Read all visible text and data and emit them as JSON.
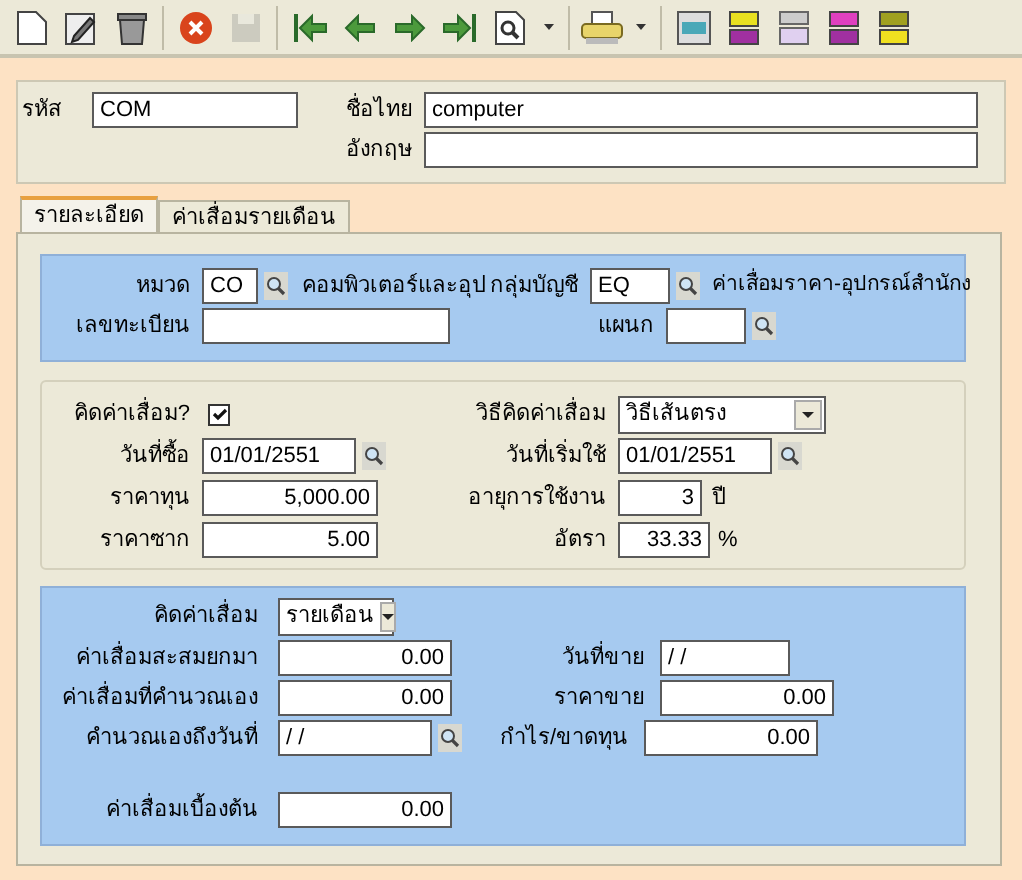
{
  "toolbar": [
    {
      "kind": "new",
      "disabled": false
    },
    {
      "kind": "edit",
      "disabled": false
    },
    {
      "kind": "delete",
      "disabled": false
    },
    {
      "kind": "separator"
    },
    {
      "kind": "cancel",
      "disabled": false
    },
    {
      "kind": "save",
      "disabled": true
    },
    {
      "kind": "separator"
    },
    {
      "kind": "first",
      "disabled": false
    },
    {
      "kind": "prev",
      "disabled": false
    },
    {
      "kind": "next",
      "disabled": false
    },
    {
      "kind": "last",
      "disabled": false
    },
    {
      "kind": "search",
      "disabled": false
    },
    {
      "kind": "dropdown",
      "disabled": false
    },
    {
      "kind": "separator"
    },
    {
      "kind": "print",
      "disabled": false
    },
    {
      "kind": "dropdown",
      "disabled": false
    },
    {
      "kind": "separator"
    },
    {
      "kind": "report",
      "disabled": false
    },
    {
      "kind": "report_yellow",
      "disabled": false
    },
    {
      "kind": "report_grey",
      "disabled": false
    },
    {
      "kind": "report_pink",
      "disabled": false
    },
    {
      "kind": "report_old",
      "disabled": false
    }
  ],
  "header": {
    "code": {
      "label": "รหัส",
      "value": "COM"
    },
    "name_th": {
      "label": "ชื่อไทย",
      "value": "computer"
    },
    "name_en": {
      "label": "อังกฤษ"
    }
  },
  "tabs": [
    {
      "label": "รายละเอียด",
      "selected": true
    },
    {
      "label": "ค่าเสื่อมรายเดือน",
      "selected": false
    }
  ],
  "classification": {
    "category": {
      "label": "หมวด",
      "value": "CO",
      "description": "คอมพิวเตอร์และอุป"
    },
    "account_group": {
      "label": "กลุ่มบัญชี",
      "value": "EQ",
      "description": "ค่าเสื่อมราคา-อุปกรณ์สำนักง"
    },
    "registration": {
      "label": "เลขทะเบียน"
    },
    "department": {
      "label": "แผนก"
    }
  },
  "depreciation": {
    "calculate": {
      "label": "คิดค่าเสื่อม?",
      "checked": true
    },
    "method": {
      "label": "วิธีคิดค่าเสื่อม",
      "value": "วิธีเส้นตรง"
    },
    "purchase_date": {
      "label": "วันที่ซื้อ",
      "value": "01/01/2551"
    },
    "start_date": {
      "label": "วันที่เริ่มใช้",
      "value": "01/01/2551"
    },
    "cost": {
      "label": "ราคาทุน",
      "value": "5,000.00"
    },
    "useful_life": {
      "label": "อายุการใช้งาน",
      "value": "3",
      "unit": "ปี"
    },
    "salvage": {
      "label": "ราคาซาก",
      "value": "5.00"
    },
    "rate": {
      "label": "อัตรา",
      "value": "33.33",
      "unit": "%"
    }
  },
  "accounting": {
    "period": {
      "label": "คิดค่าเสื่อม",
      "value": "รายเดือน"
    },
    "accumulated": {
      "label": "ค่าเสื่อมสะสมยกมา",
      "value": "0.00"
    },
    "sale_date": {
      "label": "วันที่ขาย",
      "value": "/ /"
    },
    "manual": {
      "label": "ค่าเสื่อมที่คำนวณเอง",
      "value": "0.00"
    },
    "sale_price": {
      "label": "ราคาขาย",
      "value": "0.00"
    },
    "manual_to_date": {
      "label": "คำนวณเองถึงวันที่",
      "value": "/ /"
    },
    "profit_loss": {
      "label": "กำไร/ขาดทุน",
      "value": "0.00"
    },
    "initial": {
      "label": "ค่าเสื่อมเบื้องต้น",
      "value": "0.00"
    }
  }
}
